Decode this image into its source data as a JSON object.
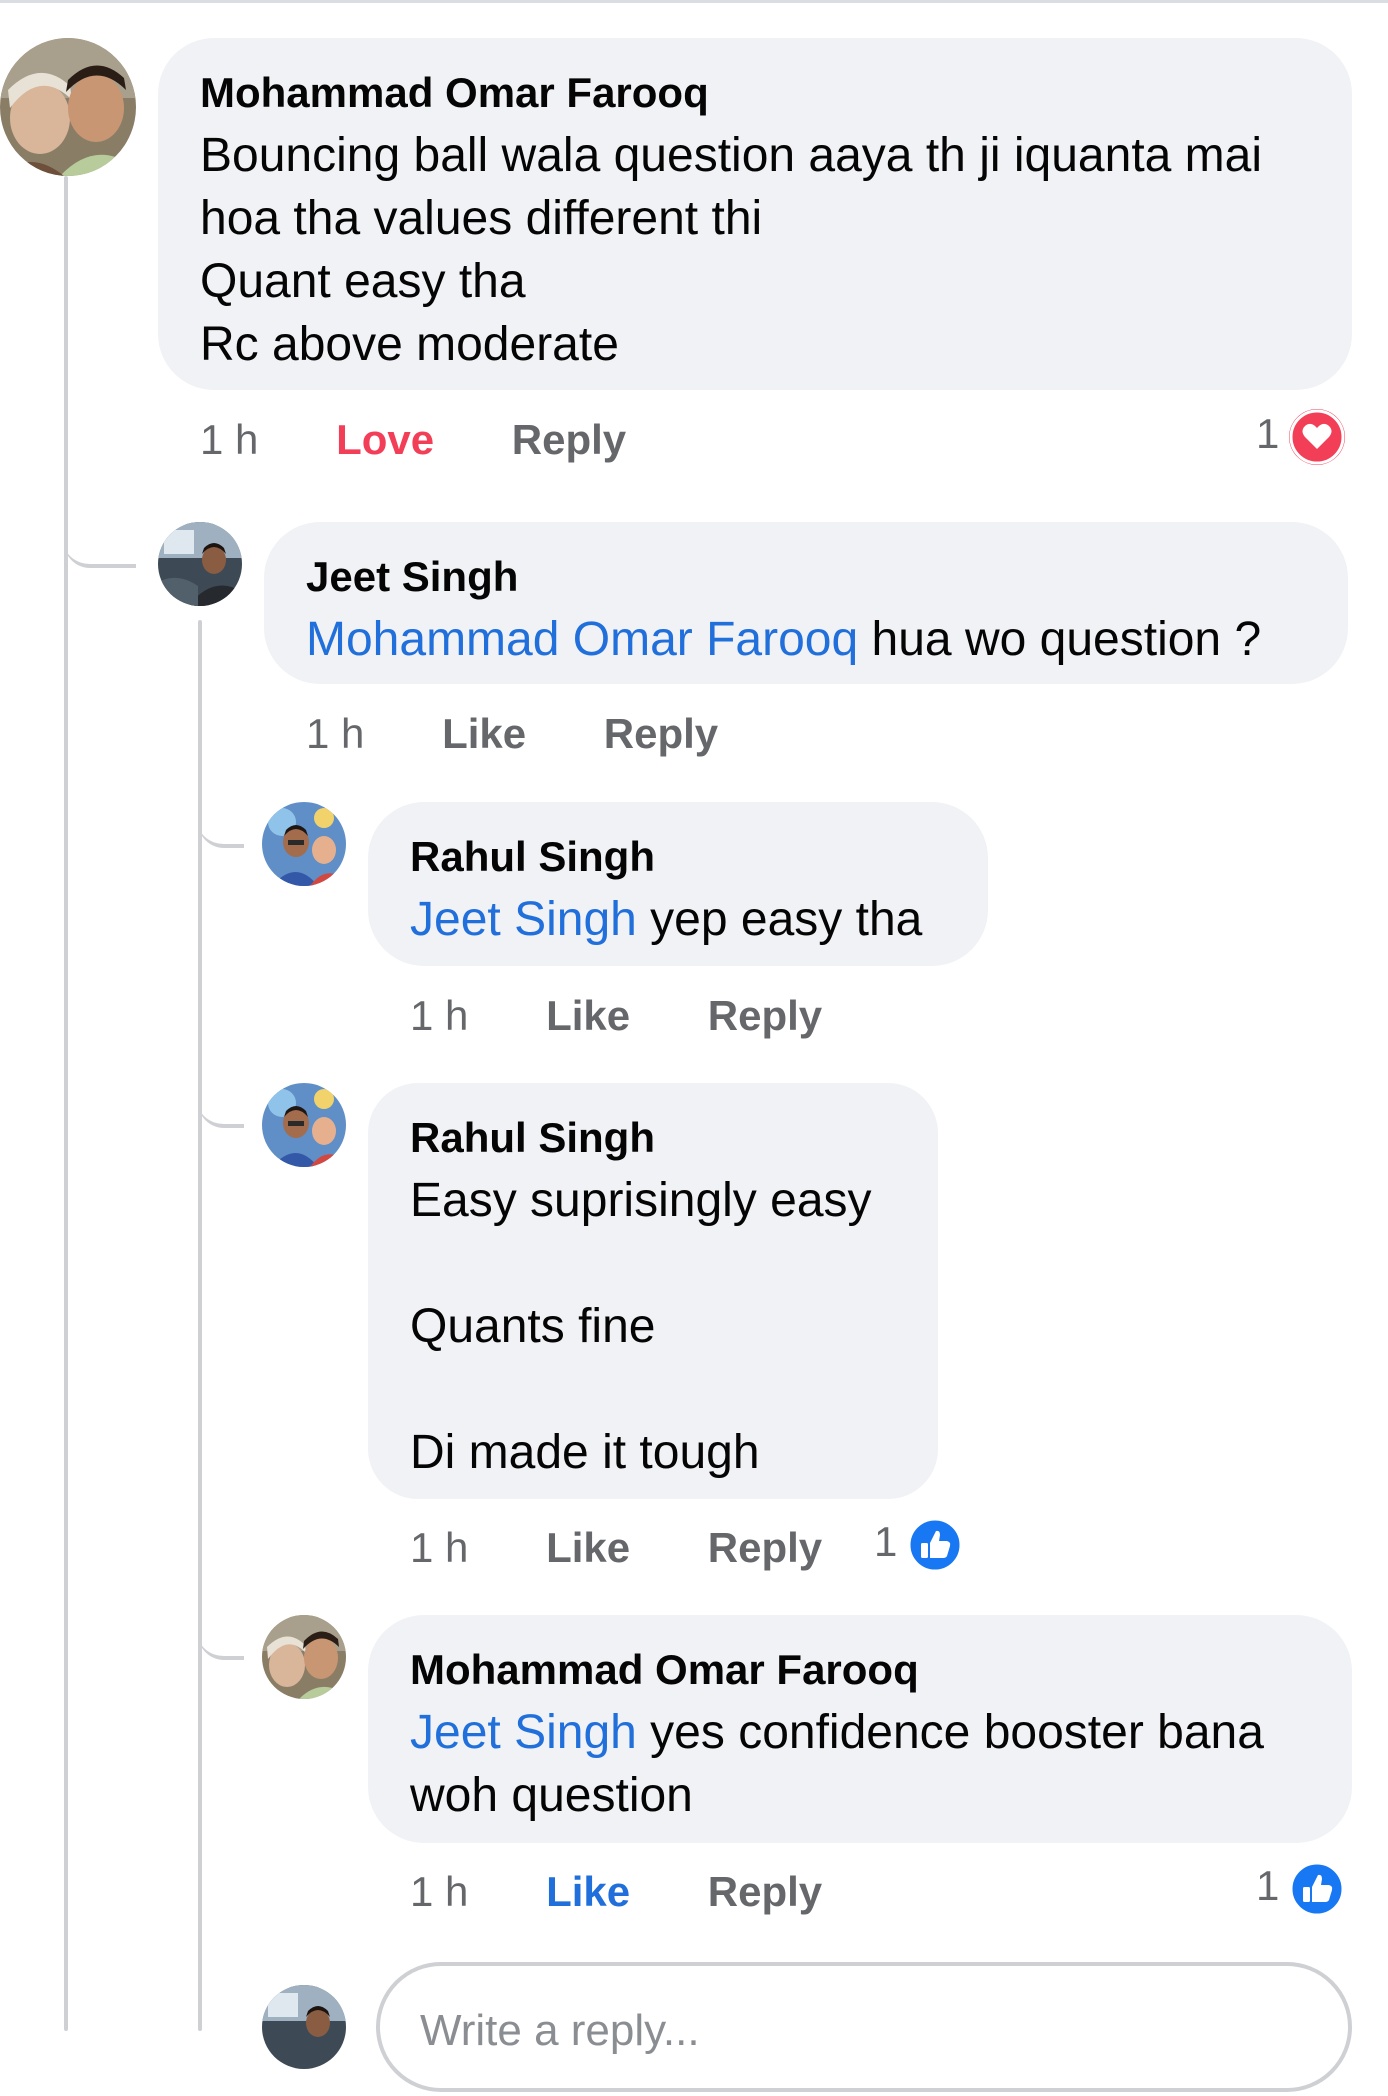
{
  "comments": [
    {
      "author": "Mohammad Omar Farooq",
      "text": "Bouncing ball wala question aaya th ji iquanta mai\nhoa tha values different thi\nQuant easy tha\nRc above moderate",
      "time": "1 h",
      "like_label": "Love",
      "like_state": "love",
      "reply_label": "Reply",
      "reaction_count": "1",
      "reaction_icon": "heart-icon",
      "reaction_color": "#f33e58"
    },
    {
      "author": "Jeet Singh",
      "mention": "Mohammad Omar Farooq",
      "text": "hua wo question ?",
      "time": "1 h",
      "like_label": "Like",
      "reply_label": "Reply"
    },
    {
      "author": "Rahul Singh",
      "mention": "Jeet Singh",
      "text": "yep easy tha",
      "time": "1 h",
      "like_label": "Like",
      "reply_label": "Reply"
    },
    {
      "author": "Rahul Singh",
      "text": "Easy suprisingly easy\n\nQuants fine\n\nDi made it tough",
      "time": "1 h",
      "like_label": "Like",
      "reply_label": "Reply",
      "reaction_count": "1",
      "reaction_icon": "thumbs-up-icon",
      "reaction_color": "#1877f2"
    },
    {
      "author": "Mohammad Omar Farooq",
      "mention": "Jeet Singh",
      "text": "yes confidence booster bana\nwoh question",
      "time": "1 h",
      "like_label": "Like",
      "like_state": "liked",
      "reply_label": "Reply",
      "reaction_count": "1",
      "reaction_icon": "thumbs-up-icon",
      "reaction_color": "#1877f2"
    }
  ],
  "reply_box": {
    "placeholder": "Write a reply..."
  },
  "colors": {
    "mention": "#216fdb",
    "bubble": "#f0f2f5",
    "meta": "#65676b",
    "love": "#f33e58",
    "like": "#1877f2"
  }
}
